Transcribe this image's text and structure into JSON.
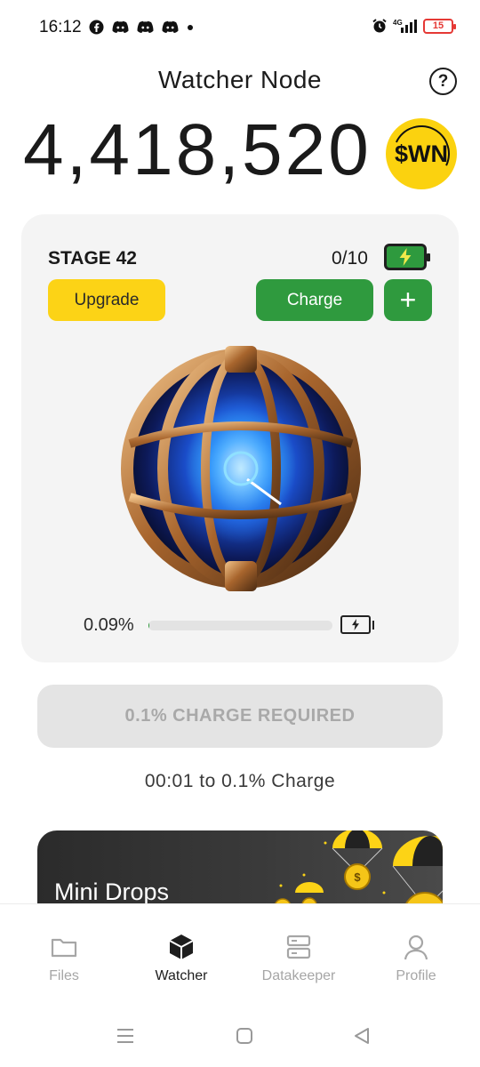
{
  "status_bar": {
    "time": "16:12",
    "left_icons": [
      "facebook-icon",
      "discord-icon",
      "discord-icon",
      "discord-icon",
      "dot-icon"
    ],
    "right_icons": [
      "alarm-icon",
      "signal-icon"
    ],
    "battery_level": "15"
  },
  "header": {
    "title": "Watcher Node",
    "help_label": "?"
  },
  "balance": {
    "amount": "4,418,520",
    "token_symbol": "$WN"
  },
  "node": {
    "stage": "STAGE 42",
    "charges": "0/10",
    "upgrade_label": "Upgrade",
    "charge_label": "Charge",
    "plus_label": "+",
    "progress_text": "0.09%",
    "progress_value": 0.0009
  },
  "charge_required_label": "0.1% CHARGE REQUIRED",
  "timer_text": "00:01  to 0.1% Charge",
  "mini_drops": {
    "title": "Mini Drops"
  },
  "bottom_nav": {
    "items": [
      {
        "label": "Files",
        "icon": "folder-icon"
      },
      {
        "label": "Watcher",
        "icon": "cube-icon"
      },
      {
        "label": "Datakeeper",
        "icon": "server-icon"
      },
      {
        "label": "Profile",
        "icon": "user-icon"
      }
    ],
    "active": "Watcher"
  },
  "colors": {
    "accent_yellow": "#fcd316",
    "accent_green": "#2f9a3e",
    "card_bg": "#f4f4f4",
    "battery_red": "#e53935"
  }
}
